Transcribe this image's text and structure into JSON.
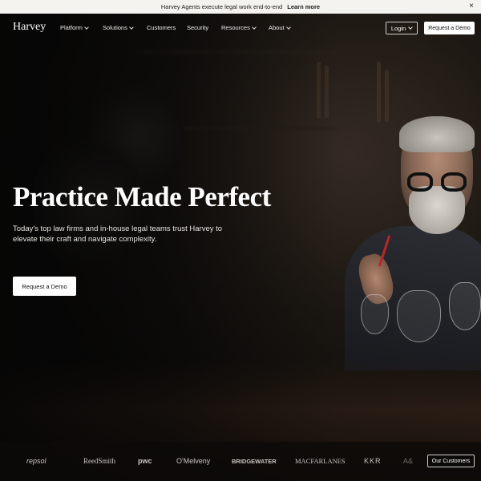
{
  "announcement": {
    "text": "Harvey Agents execute legal work end-to-end",
    "link": "Learn more",
    "close": "×"
  },
  "nav": {
    "logo": "Harvey",
    "items": [
      {
        "label": "Platform",
        "dropdown": true
      },
      {
        "label": "Solutions",
        "dropdown": true
      },
      {
        "label": "Customers",
        "dropdown": false
      },
      {
        "label": "Security",
        "dropdown": false
      },
      {
        "label": "Resources",
        "dropdown": true
      },
      {
        "label": "About",
        "dropdown": true
      }
    ],
    "login": "Login",
    "request_demo": "Request a Demo"
  },
  "hero": {
    "headline": "Practice Made Perfect",
    "subline": "Today's top law firms and in-house legal teams trust Harvey to elevate their craft and navigate complexity.",
    "cta": "Request a Demo"
  },
  "customers": {
    "logos": [
      "repsol",
      "ReedSmith",
      "pwc",
      "O'Melveny",
      "BRIDGEWATER",
      "MACFARLANES",
      "KKR",
      "A&"
    ],
    "button": "Our Customers"
  },
  "colors": {
    "background": "#0b0a09",
    "announcement_bg": "#f4f3ef",
    "button_bg": "#ffffff"
  }
}
